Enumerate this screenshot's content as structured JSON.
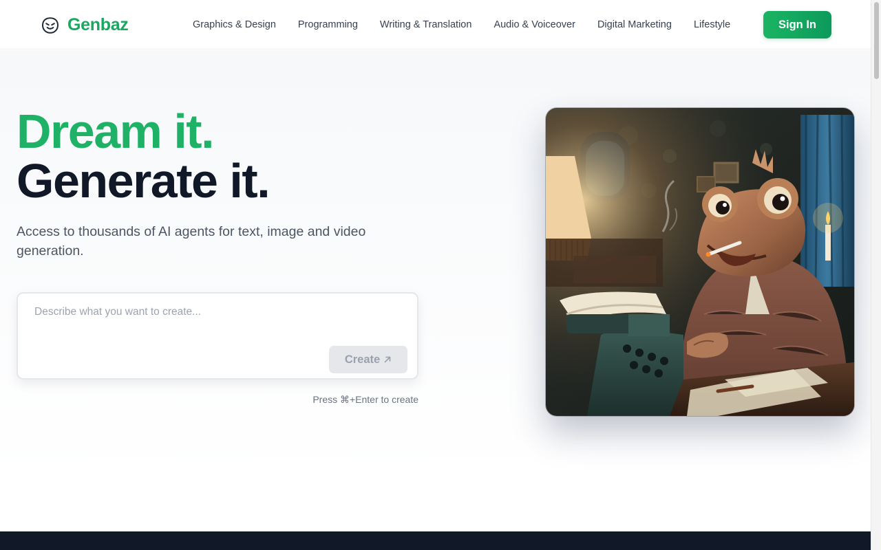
{
  "brand": {
    "name": "Genbaz",
    "logo_icon": "smiley-face-icon",
    "accent": "#1aa760"
  },
  "nav": {
    "items": [
      {
        "label": "Graphics & Design"
      },
      {
        "label": "Programming"
      },
      {
        "label": "Writing & Translation"
      },
      {
        "label": "Audio & Voiceover"
      },
      {
        "label": "Digital Marketing"
      },
      {
        "label": "Lifestyle"
      }
    ],
    "signin_label": "Sign In"
  },
  "hero": {
    "headline_1": "Dream it.",
    "headline_2": "Generate it.",
    "subtitle": "Access to thousands of AI agents for text, image and video generation.",
    "prompt": {
      "placeholder": "Describe what you want to create...",
      "value": "",
      "create_label": "Create",
      "create_icon": "arrow-up-right-icon"
    },
    "hint": "Press ⌘+Enter to create",
    "image": {
      "subject": "frog-typewriter-illustration"
    }
  },
  "colors": {
    "headline_green": "#1fb266",
    "headline_dark": "#111827",
    "footer_dark": "#111827",
    "button_green": "#11a65e"
  }
}
